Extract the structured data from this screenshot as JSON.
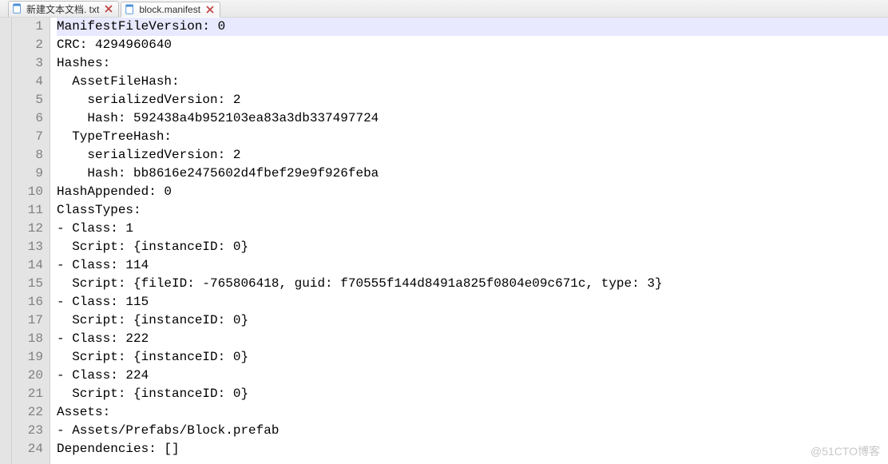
{
  "tabs": [
    {
      "label": "新建文本文档. txt",
      "active": false
    },
    {
      "label": "block.manifest",
      "active": true
    }
  ],
  "watermark": "@51CTO博客",
  "lines": [
    {
      "num": "1",
      "text": "ManifestFileVersion: 0",
      "highlight": true
    },
    {
      "num": "2",
      "text": "CRC: 4294960640"
    },
    {
      "num": "3",
      "text": "Hashes:"
    },
    {
      "num": "4",
      "text": "  AssetFileHash:"
    },
    {
      "num": "5",
      "text": "    serializedVersion: 2"
    },
    {
      "num": "6",
      "text": "    Hash: 592438a4b952103ea83a3db337497724"
    },
    {
      "num": "7",
      "text": "  TypeTreeHash:"
    },
    {
      "num": "8",
      "text": "    serializedVersion: 2"
    },
    {
      "num": "9",
      "text": "    Hash: bb8616e2475602d4fbef29e9f926feba"
    },
    {
      "num": "10",
      "text": "HashAppended: 0"
    },
    {
      "num": "11",
      "text": "ClassTypes:"
    },
    {
      "num": "12",
      "text": "- Class: 1"
    },
    {
      "num": "13",
      "text": "  Script: {instanceID: 0}"
    },
    {
      "num": "14",
      "text": "- Class: 114"
    },
    {
      "num": "15",
      "text": "  Script: {fileID: -765806418, guid: f70555f144d8491a825f0804e09c671c, type: 3}"
    },
    {
      "num": "16",
      "text": "- Class: 115"
    },
    {
      "num": "17",
      "text": "  Script: {instanceID: 0}"
    },
    {
      "num": "18",
      "text": "- Class: 222"
    },
    {
      "num": "19",
      "text": "  Script: {instanceID: 0}"
    },
    {
      "num": "20",
      "text": "- Class: 224"
    },
    {
      "num": "21",
      "text": "  Script: {instanceID: 0}"
    },
    {
      "num": "22",
      "text": "Assets:"
    },
    {
      "num": "23",
      "text": "- Assets/Prefabs/Block.prefab"
    },
    {
      "num": "24",
      "text": "Dependencies: []"
    }
  ]
}
